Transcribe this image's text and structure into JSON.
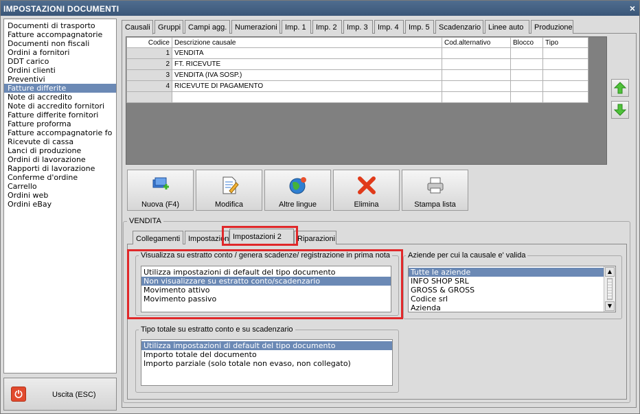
{
  "window": {
    "title": "IMPOSTAZIONI DOCUMENTI",
    "close": "×"
  },
  "sidebar": {
    "items": [
      {
        "label": "Documenti di trasporto"
      },
      {
        "label": "Fatture accompagnatorie"
      },
      {
        "label": "Documenti non fiscali"
      },
      {
        "label": "Ordini a fornitori"
      },
      {
        "label": "DDT carico"
      },
      {
        "label": "Ordini clienti"
      },
      {
        "label": "Preventivi"
      },
      {
        "label": "Fatture differite",
        "selected": true
      },
      {
        "label": "Note di accredito"
      },
      {
        "label": "Note di accredito fornitori"
      },
      {
        "label": "Fatture differite fornitori"
      },
      {
        "label": "Fatture proforma"
      },
      {
        "label": "Fatture accompagnatorie fo"
      },
      {
        "label": "Ricevute di cassa"
      },
      {
        "label": "Lanci di produzione"
      },
      {
        "label": "Ordini di lavorazione"
      },
      {
        "label": "Rapporti di lavorazione"
      },
      {
        "label": "Conferme d'ordine"
      },
      {
        "label": "Carrello"
      },
      {
        "label": "Ordini web"
      },
      {
        "label": "Ordini eBay"
      }
    ]
  },
  "exit_button": {
    "label": "Uscita (ESC)"
  },
  "tabs": [
    "Causali",
    "Gruppi",
    "Campi agg.",
    "Numerazioni",
    "Imp. 1",
    "Imp. 2",
    "Imp. 3",
    "Imp. 4",
    "Imp. 5",
    "Scadenzario",
    "Linee auto",
    "Produzione"
  ],
  "grid": {
    "headers": [
      "Codice",
      "Descrizione causale",
      "Cod.alternativo",
      "Blocco",
      "Tipo"
    ],
    "rows": [
      [
        "1",
        "VENDITA",
        "",
        "",
        ""
      ],
      [
        "2",
        "FT. RICEVUTE",
        "",
        "",
        ""
      ],
      [
        "3",
        "VENDITA (IVA SOSP.)",
        "",
        "",
        ""
      ],
      [
        "4",
        "RICEVUTE DI PAGAMENTO",
        "",
        "",
        ""
      ],
      [
        "",
        "",
        "",
        "",
        ""
      ]
    ]
  },
  "actions": [
    "Nuova (F4)",
    "Modifica",
    "Altre lingue",
    "Elimina",
    "Stampa lista"
  ],
  "detail": {
    "group_title": "VENDITA",
    "subtabs": [
      "Collegamenti",
      "Impostazioni",
      "Impostazioni 2",
      "Riparazioni"
    ],
    "estratto": {
      "label": "Visualizza su estratto conto / genera scadenze/ registrazione  in prima nota",
      "options": [
        {
          "label": "Utilizza impostazioni di default del tipo documento"
        },
        {
          "label": "Non visualizzare su estratto conto/scadenzario",
          "selected": true
        },
        {
          "label": "Movimento attivo"
        },
        {
          "label": "Movimento passivo"
        }
      ]
    },
    "aziende": {
      "label": "Aziende per cui la causale e' valida",
      "options": [
        {
          "label": "Tutte le aziende",
          "selected": true
        },
        {
          "label": "INFO SHOP SRL"
        },
        {
          "label": "GROSS & GROSS"
        },
        {
          "label": "Codice srl"
        },
        {
          "label": "Azienda"
        }
      ]
    },
    "totale": {
      "label": "Tipo totale su estratto conto e su scadenzario",
      "options": [
        {
          "label": "Utilizza impostazioni di default del tipo documento",
          "selected": true
        },
        {
          "label": "Importo totale del documento"
        },
        {
          "label": "Importo parziale (solo totale non evaso, non collegato)"
        }
      ]
    }
  }
}
